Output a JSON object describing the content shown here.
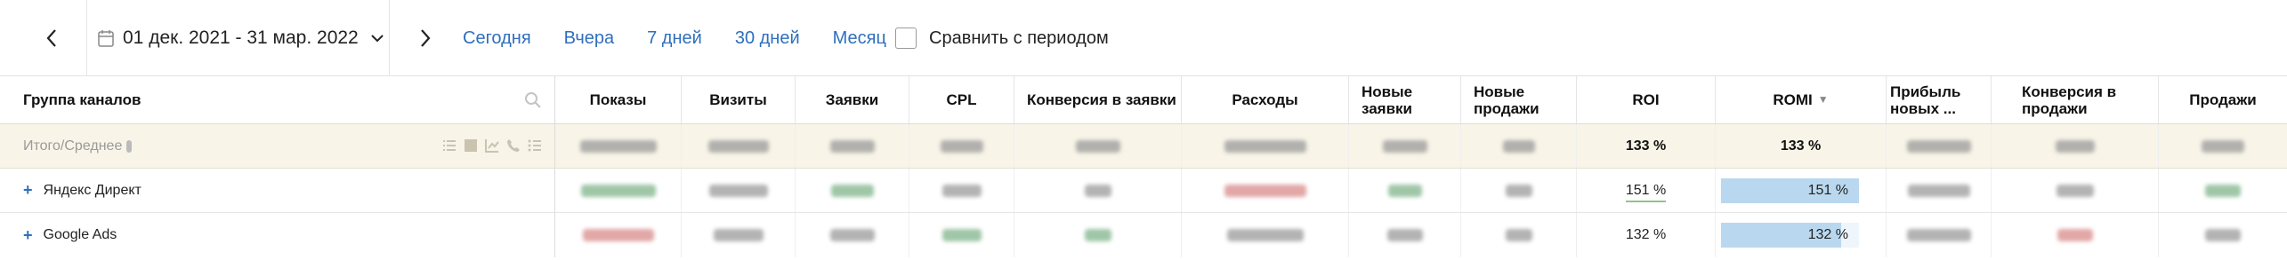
{
  "toolbar": {
    "date_range": "01 дек. 2021 - 31 мар. 2022",
    "quick_links": [
      "Сегодня",
      "Вчера",
      "7 дней",
      "30 дней",
      "Месяц"
    ],
    "compare_label": "Сравнить с периодом"
  },
  "table": {
    "group_header": "Группа каналов",
    "columns": {
      "shows": "Показы",
      "visits": "Визиты",
      "requests": "Заявки",
      "cpl": "CPL",
      "conv_req": "Конверсия в заявки",
      "expenses": "Расходы",
      "new_req": "Новые заявки",
      "new_sales": "Новые продажи",
      "roi": "ROI",
      "romi": "ROMI",
      "profit": "Прибыль новых ...",
      "conv_sales": "Конверсия в продажи",
      "sales": "Продажи"
    },
    "sort_indicator": "▼",
    "total": {
      "label": "Итого/Среднее",
      "roi": "133 %",
      "romi": "133 %"
    },
    "rows": [
      {
        "name": "Яндекс Директ",
        "expand": "+",
        "roi": "151 %",
        "romi": "151 %",
        "romi_level": 1.0
      },
      {
        "name": "Google Ads",
        "expand": "+",
        "roi": "132 %",
        "romi": "132 %",
        "romi_level": 0.87
      }
    ]
  },
  "colors": {
    "link": "#2f6fbd",
    "total_bg": "#f8f4e8",
    "romi_bar": "#b9d8ef",
    "roi_underline": "#8cc68d"
  }
}
